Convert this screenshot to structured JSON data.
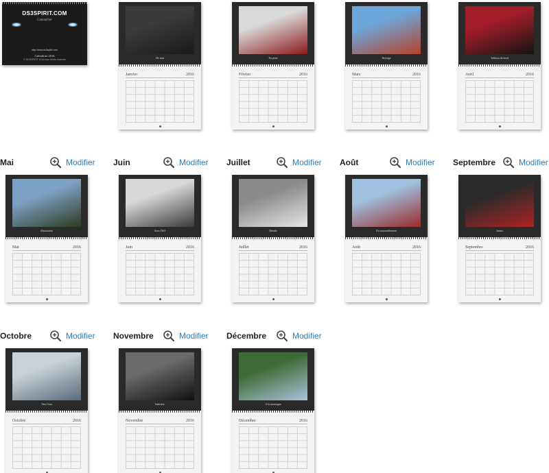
{
  "cover": {
    "logo": "DS3SPIRIT.COM",
    "script": "Calendrier",
    "site": "http://www.ds3spirit.com",
    "title": "Calendrier 2016",
    "copyright": "© DS3SPIRIT 2016 tous droits réservés"
  },
  "modify_label": "Modifier",
  "year": "2016",
  "top_months": [
    {
      "name": "Janvier",
      "caption": "De nuit",
      "photo_colors": [
        "#1a1a1a",
        "#3b3b3b"
      ]
    },
    {
      "name": "Février",
      "caption": "En piste",
      "photo_colors": [
        "#8b1a1a",
        "#d9d9d9"
      ]
    },
    {
      "name": "Mars",
      "caption": "Paysage",
      "photo_colors": [
        "#b5412a",
        "#6da6d8"
      ]
    },
    {
      "name": "Avril",
      "caption": "Tableau de bord",
      "photo_colors": [
        "#141414",
        "#a31d2a"
      ]
    }
  ],
  "rows": [
    [
      {
        "name": "Mai",
        "label": "Mai",
        "caption": "Monument",
        "photo_colors": [
          "#2e3b22",
          "#7ea2c6"
        ]
      },
      {
        "name": "Juin",
        "label": "Juin",
        "caption": "Sous DS3",
        "photo_colors": [
          "#3a3a3a",
          "#d8d8d8"
        ]
      },
      {
        "name": "Juillet",
        "label": "Juillet",
        "caption": "Détails",
        "photo_colors": [
          "#e6e6e6",
          "#8a8a8a"
        ]
      },
      {
        "name": "Août",
        "label": "Août",
        "caption": "En rassemblement",
        "photo_colors": [
          "#9b2a2a",
          "#9fc1e0"
        ]
      },
      {
        "name": "Septembre",
        "label": "Septembre",
        "caption": "Jantes",
        "photo_colors": [
          "#b02323",
          "#2a2a2a"
        ]
      }
    ],
    [
      {
        "name": "Octobre",
        "label": "Octobre",
        "caption": "Vers l'eau",
        "photo_colors": [
          "#5a6b7a",
          "#c9d2d8"
        ]
      },
      {
        "name": "Novembre",
        "label": "Novembre",
        "caption": "Intérieur",
        "photo_colors": [
          "#111111",
          "#6a6a6a"
        ]
      },
      {
        "name": "Décembre",
        "label": "Décembre",
        "caption": "A la montagne",
        "photo_colors": [
          "#a8c3dc",
          "#3e6b35"
        ]
      }
    ]
  ]
}
